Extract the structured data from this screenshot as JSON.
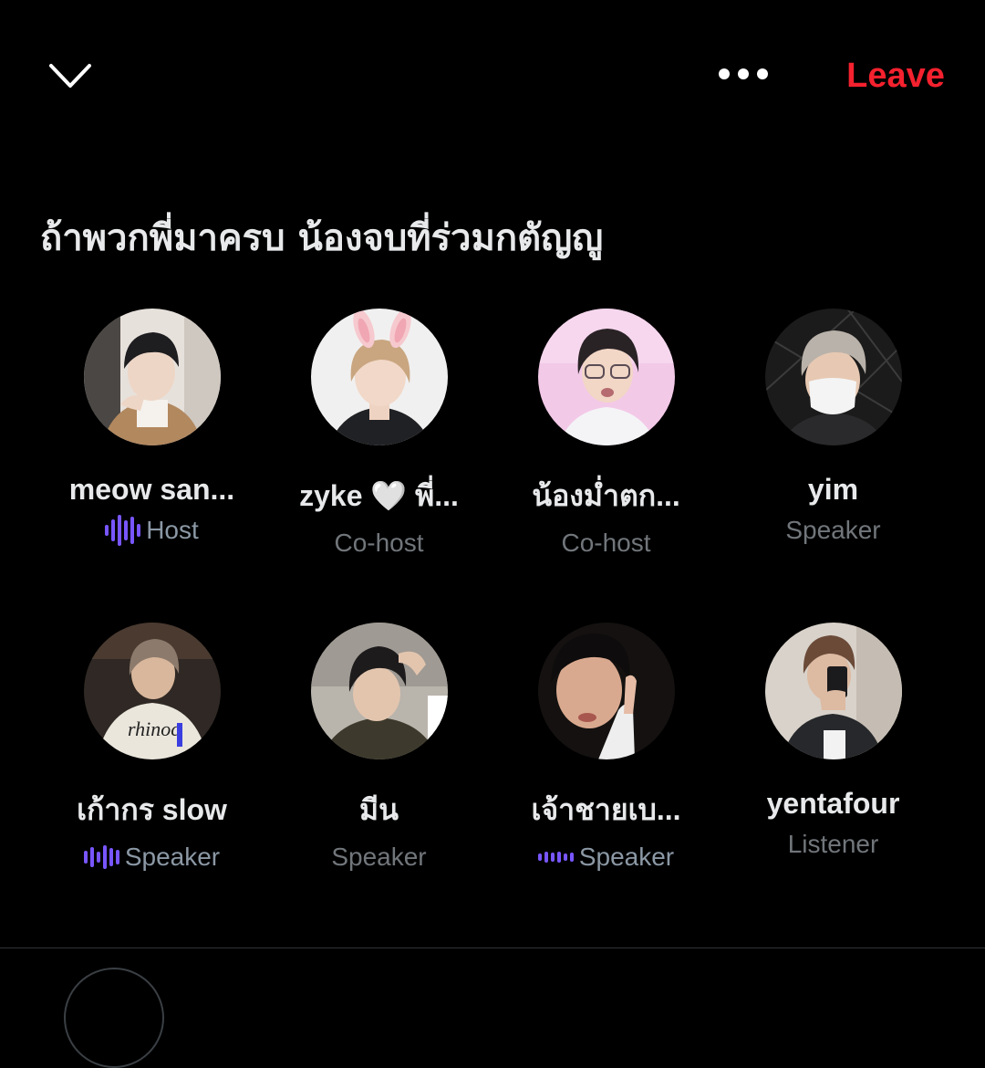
{
  "header": {
    "collapse_icon": "chevron-down-icon",
    "more_icon": "more-horizontal-icon",
    "leave_label": "Leave",
    "leave_color": "#f4212e"
  },
  "space": {
    "title": "ถ้าพวกพี่มาครบ น้องจบที่ร่วมกตัญญู"
  },
  "colors": {
    "background": "#000000",
    "accent_wave": "#7856ff",
    "text_primary": "#e7e9ea",
    "text_secondary": "#71767b"
  },
  "participants": [
    {
      "name": "meow san...",
      "role": "Host",
      "speaking": true,
      "wave_icon": "audio-wave-icon"
    },
    {
      "name": "zyke 🤍 พี่...",
      "role": "Co-host",
      "speaking": false
    },
    {
      "name": "น้องม่ำตก...",
      "role": "Co-host",
      "speaking": false
    },
    {
      "name": "yim",
      "role": "Speaker",
      "speaking": false
    },
    {
      "name": "เก้ากร slow",
      "role": "Speaker",
      "speaking": true,
      "wave_icon": "audio-wave-icon"
    },
    {
      "name": "มีน",
      "role": "Speaker",
      "speaking": false
    },
    {
      "name": "เจ้าชายเบ...",
      "role": "Speaker",
      "speaking": true,
      "wave_icon": "audio-wave-icon"
    },
    {
      "name": "yentafour",
      "role": "Listener",
      "speaking": false
    }
  ]
}
